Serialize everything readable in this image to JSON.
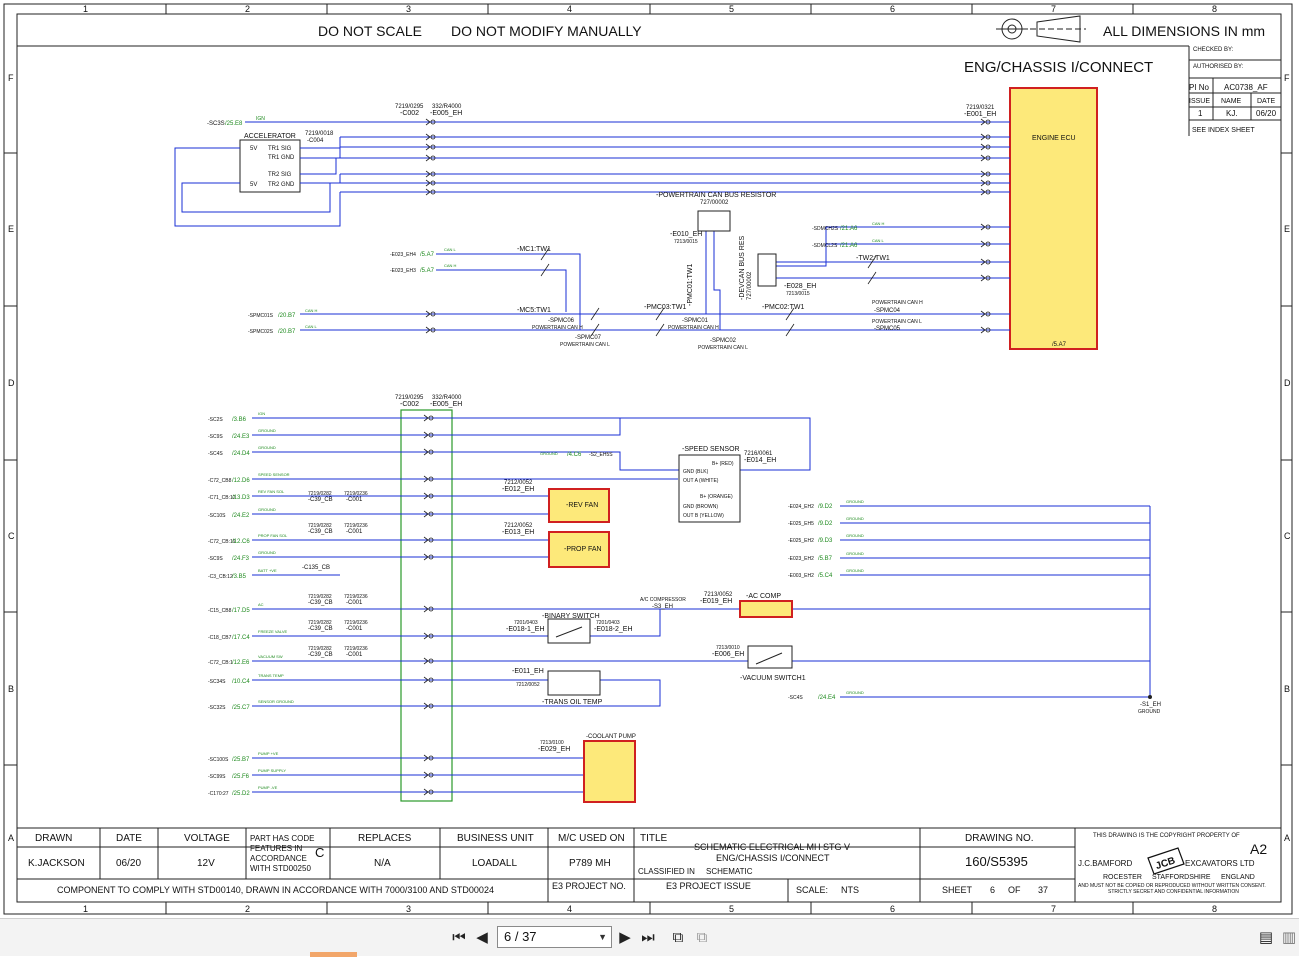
{
  "header": {
    "notice_scale": "DO NOT SCALE",
    "notice_modify": "DO NOT MODIFY MANUALLY",
    "dimensions_note": "ALL DIMENSIONS IN mm",
    "diagram_title": "ENG/CHASSIS I/CONNECT"
  },
  "grid": {
    "columns": [
      "1",
      "2",
      "3",
      "4",
      "5",
      "6",
      "7",
      "8"
    ],
    "rows": [
      "F",
      "E",
      "D",
      "C",
      "B",
      "A"
    ]
  },
  "side_panel": {
    "checked_by": "CHECKED BY:",
    "authorised_by": "AUTHORISED BY:",
    "pi_no_label": "PI No",
    "pi_no_value": "AC0738_AF",
    "issue_label": "ISSUE",
    "name_label": "NAME",
    "date_label": "DATE",
    "issue_value": "1",
    "name_value": "KJ.",
    "date_value": "06/20",
    "index_note": "SEE INDEX SHEET"
  },
  "components": {
    "engine_ecu": "ENGINE ECU",
    "engine_ecu_ref": "7219/0321",
    "engine_ecu_conn": "-E001_EH",
    "engine_ecu_loc": "/5.A7",
    "accelerator": "ACCELERATOR",
    "accel_ref": "7219/0018",
    "accel_conn": "-C004",
    "accel_pins": [
      "5V",
      "TR1 SIG",
      "TR1 GND",
      "TR2 SIG",
      "5V",
      "TR2 GND"
    ],
    "conn_c002_ref": "7219/0295",
    "conn_c002": "-C002",
    "conn_e005_ref": "332/R4000",
    "conn_e005": "-E005_EH",
    "can_resistor": "-POWERTRAIN CAN BUS RESISTOR",
    "can_resistor_ref": "727/00002",
    "can_resistor_conn": "-E010_EH",
    "can_resistor_conn_ref": "7213/0015",
    "devcan_resistor": "-DEVCAN BUS RES",
    "devcan_ref": "727/00002",
    "devcan_conn": "-E028_EH",
    "devcan_conn_ref": "7213/0015",
    "speed_sensor": "-SPEED SENSOR",
    "speed_sensor_ref": "7216/0061",
    "speed_sensor_conn": "-E014_EH",
    "speed_sensor_pins": [
      "B+ (RED)",
      "GND (BLK)",
      "OUT A (WHITE)",
      "B+ (ORANGE)",
      "GND (BROWN)",
      "OUT B (YELLOW)"
    ],
    "rev_fan": "-REV FAN",
    "rev_fan_ref": "7212/0052",
    "rev_fan_conn": "-E012_EH",
    "prop_fan": "-PROP FAN",
    "prop_fan_ref": "7212/0052",
    "prop_fan_conn": "-E013_EH",
    "ac_comp": "-AC COMP",
    "ac_comp_ref": "7213/0052",
    "ac_comp_conn": "-E019_EH",
    "ac_compressor_label": "A/C COMPRESSOR",
    "ac_compressor_conn": "-S3_EH",
    "binary_switch": "-BINARY SWITCH",
    "binary_ref_a": "7201/0403",
    "binary_conn_a": "-E018-1_EH",
    "binary_ref_b": "7201/0403",
    "binary_conn_b": "-E018-2_EH",
    "vacuum_switch": "-VACUUM SWITCH1",
    "vacuum_ref": "7213/0010",
    "vacuum_conn": "-E006_EH",
    "trans_oil_temp": "-TRANS OIL TEMP",
    "trans_ref": "7212/0052",
    "trans_conn": "-E011_EH",
    "coolant_pump": "-COOLANT PUMP",
    "coolant_ref": "7213/0100",
    "coolant_conn": "-E029_EH",
    "ground_point": "-S1_EH",
    "ground_label": "GROUND",
    "tw_mc1": "-MC1:TW1",
    "tw_mc5": "-MC5:TW1",
    "tw_pmc01": "-PMC01:TW1",
    "tw_pmc03": "-PMC03:TW1",
    "tw_pmc02": "-PMC02:TW1",
    "tw_tw2": "-TW2:TW1",
    "spmc07": "-SPMC07",
    "spmc06": "-SPMC06",
    "spmc01": "-SPMC01",
    "spmc02": "-SPMC02",
    "spmc04": "-SPMC04",
    "spmc05": "-SPMC05",
    "powertrain_can_h": "POWERTRAIN CAN H",
    "powertrain_can_l": "POWERTRAIN CAN L",
    "c39_ref": "7219/0282",
    "c39": "-C39_CB",
    "c001_ref": "7219/0236",
    "c001": "-C001",
    "c135": "-C135_CB"
  },
  "upper_signals": [
    {
      "ref": "-SC3S",
      "loc": "/25.E8",
      "desc": "IGN"
    },
    {
      "ref": "-E023_EH4",
      "loc": "/5.A7",
      "desc": "CAN L"
    },
    {
      "ref": "-E023_EH3",
      "loc": "/5.A7",
      "desc": "CAN H"
    },
    {
      "ref": "-SPMC01S",
      "loc": "/20.B7",
      "desc": "CAN H"
    },
    {
      "ref": "-SPMC02S",
      "loc": "/20.B7",
      "desc": "CAN L"
    },
    {
      "ref": "-SDMCH2S",
      "loc": "/21.A6",
      "desc": "CAN H"
    },
    {
      "ref": "-SDMCL2S",
      "loc": "/21.A6",
      "desc": "CAN L"
    }
  ],
  "lower_signals": [
    {
      "ref": "-SC2S",
      "loc": "/3.B6",
      "desc": "IGN"
    },
    {
      "ref": "-SC9S",
      "loc": "/24.E3",
      "desc": "GROUND"
    },
    {
      "ref": "-SC4S",
      "loc": "/24.D4",
      "desc": "GROUND"
    },
    {
      "ref": "-C72_CB8",
      "loc": "/12.D6",
      "desc": "SPEED SENSOR"
    },
    {
      "ref": "-C71_CB:12",
      "loc": "/13.D3",
      "desc": "REV FAN SOL"
    },
    {
      "ref": "-SC10S",
      "loc": "/24.E2",
      "desc": "GROUND"
    },
    {
      "ref": "-C72_CB:19",
      "loc": "/12.C6",
      "desc": "PROP FAN SOL"
    },
    {
      "ref": "-SC9S",
      "loc": "/24.F3",
      "desc": "GROUND"
    },
    {
      "ref": "-C3_CB:12",
      "loc": "/3.B5",
      "desc": "BATT +VE"
    },
    {
      "ref": "-C15_CB8",
      "loc": "/17.D5",
      "desc": "AC"
    },
    {
      "ref": "-C18_CB7",
      "loc": "/17.C4",
      "desc": "FREEZE VALVE"
    },
    {
      "ref": "-C72_CB:1",
      "loc": "/12.E6",
      "desc": "VACUUM SW"
    },
    {
      "ref": "-SC34S",
      "loc": "/10.C4",
      "desc": "TRANS TEMP"
    },
    {
      "ref": "-SC32S",
      "loc": "/25.C7",
      "desc": "SENSOR GROUND"
    },
    {
      "ref": "-SC100S",
      "loc": "/25.B7",
      "desc": "PUMP +VE"
    },
    {
      "ref": "-SC99S",
      "loc": "/25.F6",
      "desc": "PUMP SUPPLY"
    },
    {
      "ref": "-C170:27",
      "loc": "/25.D2",
      "desc": "PUMP -VE"
    }
  ],
  "right_grounds": [
    {
      "ref": "-E024_EH2",
      "loc": "/9.D2",
      "desc": "GROUND"
    },
    {
      "ref": "-E025_EH5",
      "loc": "/9.D2",
      "desc": "GROUND"
    },
    {
      "ref": "-E025_EH2",
      "loc": "/9.D3",
      "desc": "GROUND"
    },
    {
      "ref": "-E023_EH2",
      "loc": "/5.B7",
      "desc": "GROUND"
    },
    {
      "ref": "-E003_EH2",
      "loc": "/5.C4",
      "desc": "GROUND"
    },
    {
      "ref": "-SC4S",
      "loc": "/24.E4",
      "desc": "GROUND"
    }
  ],
  "speed_link": {
    "ref": "-S2_EH5S",
    "loc": "/4.C6",
    "desc": "GROUND"
  },
  "title_block": {
    "drawn_label": "DRAWN",
    "drawn_value": "K.JACKSON",
    "date_label": "DATE",
    "date_value": "06/20",
    "voltage_label": "VOLTAGE",
    "voltage_value": "12V",
    "code_note_1": "PART HAS CODE",
    "code_note_2": "FEATURES IN",
    "code_note_3": "ACCORDANCE",
    "code_note_4": "WITH STD00250",
    "code_letter": "C",
    "replaces_label": "REPLACES",
    "replaces_value": "N/A",
    "business_unit_label": "BUSINESS UNIT",
    "business_unit_value": "LOADALL",
    "mc_used_label": "M/C USED ON",
    "mc_used_value": "P789 MH",
    "title_label": "TITLE",
    "title_line1": "SCHEMATIC ELECTRICAL MH STG V",
    "title_line2": "ENG/CHASSIS I/CONNECT",
    "classified_label": "CLASSIFIED IN",
    "classified_value": "SCHEMATIC",
    "drawing_no_label": "DRAWING NO.",
    "drawing_no_value": "160/S5395",
    "copyright": "THIS DRAWING IS THE COPYRIGHT PROPERTY OF",
    "size": "A2",
    "company_left": "J.C.BAMFORD",
    "company_right": "EXCAVATORS LTD",
    "addr_1": "ROCESTER",
    "addr_2": "STAFFORDSHIRE",
    "addr_3": "ENGLAND",
    "confidential_1": "AND MUST NOT BE COPIED OR REPRODUCED WITHOUT WRITTEN CONSENT.",
    "confidential_2": "STRICTLY SECRET AND CONFIDENTIAL INFORMATION",
    "logo": "JCB",
    "compliance": "COMPONENT TO COMPLY WITH STD00140, DRAWN IN ACCORDANCE WITH 7000/3100 AND STD00024",
    "e3_project_no": "E3 PROJECT NO.",
    "e3_project_issue": "E3 PROJECT ISSUE",
    "scale_label": "SCALE:",
    "scale_value": "NTS",
    "sheet_label": "SHEET",
    "sheet_value": "6",
    "of_label": "OF",
    "of_value": "37"
  },
  "viewer": {
    "page_display": "6 / 37",
    "first_icon": "first-page-icon",
    "prev_icon": "previous-page-icon",
    "next_icon": "next-page-icon",
    "last_icon": "last-page-icon"
  },
  "colors": {
    "wire": "#1a2fd6",
    "label_green": "#1e8a1e",
    "component_fill": "#fde97a",
    "component_border": "#d02020",
    "connector_box": "#2a9a2a",
    "border": "#222222"
  }
}
